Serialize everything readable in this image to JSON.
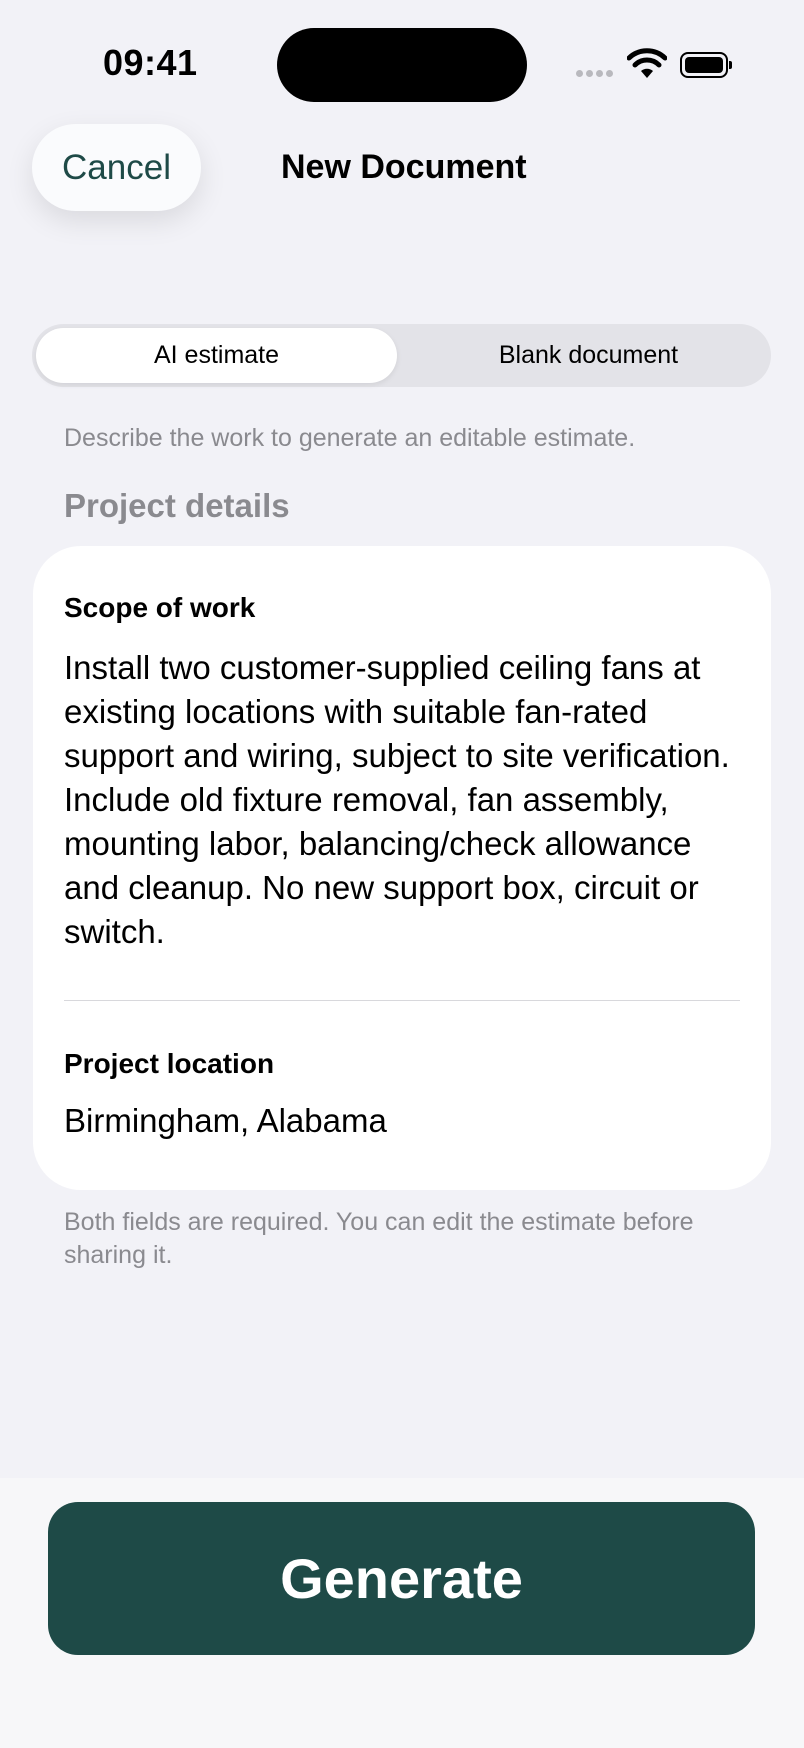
{
  "status_bar": {
    "time": "09:41"
  },
  "nav": {
    "cancel_label": "Cancel",
    "title": "New Document"
  },
  "mode_selector": {
    "options": [
      "AI estimate",
      "Blank document"
    ],
    "selected": "AI estimate"
  },
  "mode_description": "Describe the work to generate an editable estimate.",
  "project_details": {
    "section_title": "Project details",
    "scope_label": "Scope of work",
    "scope_value": "Install two customer-supplied ceiling fans at existing locations with suitable fan-rated support and wiring, subject to site verification. Include old fixture removal, fan assembly, mounting labor, balancing/check allowance and cleanup. No new support box, circuit or switch.",
    "location_label": "Project location",
    "location_value": "Birmingham, Alabama"
  },
  "footnote": "Both fields are required. You can edit the estimate before sharing it.",
  "primary_action": {
    "label": "Generate"
  },
  "colors": {
    "accent": "#1e4a47",
    "background": "#f2f2f7",
    "secondary_text": "#8a8a8f"
  }
}
